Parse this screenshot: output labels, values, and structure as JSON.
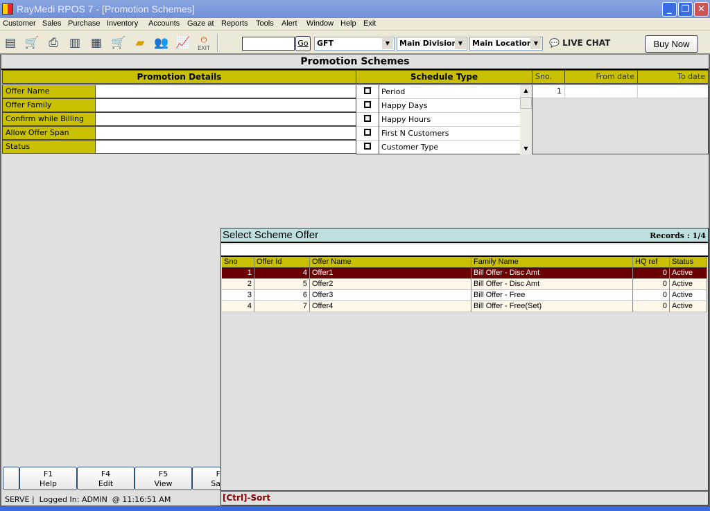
{
  "window": {
    "title": "RayMedi RPOS 7 - [Promotion Schemes]"
  },
  "menu": [
    "Customer",
    "Sales",
    "Purchase",
    "Inventory",
    "Accounts",
    "Gaze at",
    "Reports",
    "Tools",
    "Alert",
    "Window",
    "Help",
    "Exit"
  ],
  "toolbar": {
    "exit_label": "EXIT",
    "search_value": "",
    "go_label": "Go",
    "company": "GFT",
    "division": "Main Division",
    "location": "Main Location",
    "live_chat": "LIVE CHAT",
    "buy_now": "Buy Now"
  },
  "form": {
    "title": "Promotion Schemes",
    "details_header": "Promotion Details",
    "fields": [
      "Offer Name",
      "Offer Family",
      "Confirm while Billing",
      "Allow Offer Span",
      "Status"
    ],
    "schedule_header": "Schedule Type",
    "schedule_types": [
      "Period",
      "Happy Days",
      "Happy Hours",
      "First N Customers",
      "Customer Type"
    ],
    "date_grid": {
      "headers": [
        "Sno.",
        "From date",
        "To date"
      ],
      "rows": [
        [
          "1",
          "",
          ""
        ]
      ]
    }
  },
  "popup": {
    "title": "Select Scheme Offer",
    "records": "Records : 1/4",
    "search": "",
    "columns": [
      "Sno",
      "Offer Id",
      "Offer Name",
      "Family Name",
      "HQ ref",
      "Status"
    ],
    "rows": [
      [
        "1",
        "4",
        "Offer1",
        "Bill Offer - Disc Amt",
        "0",
        "Active"
      ],
      [
        "2",
        "5",
        "Offer2",
        "Bill Offer - Disc Amt",
        "0",
        "Active"
      ],
      [
        "3",
        "6",
        "Offer3",
        "Bill Offer - Free",
        "0",
        "Active"
      ],
      [
        "4",
        "7",
        "Offer4",
        "Bill Offer - Free(Set)",
        "0",
        "Active"
      ]
    ],
    "footer": "[Ctrl]-Sort"
  },
  "fkeys": [
    {
      "key": "F1",
      "label": "Help"
    },
    {
      "key": "F4",
      "label": "Edit"
    },
    {
      "key": "F5",
      "label": "View"
    },
    {
      "key": "F",
      "label": "Sa"
    }
  ],
  "status": "SERVE |  Logged In: ADMIN  @ 11:16:51 AM",
  "colors": {
    "header": "#c8c000",
    "selected_row": "#6b0000",
    "popup_title": "#bfe0de"
  }
}
